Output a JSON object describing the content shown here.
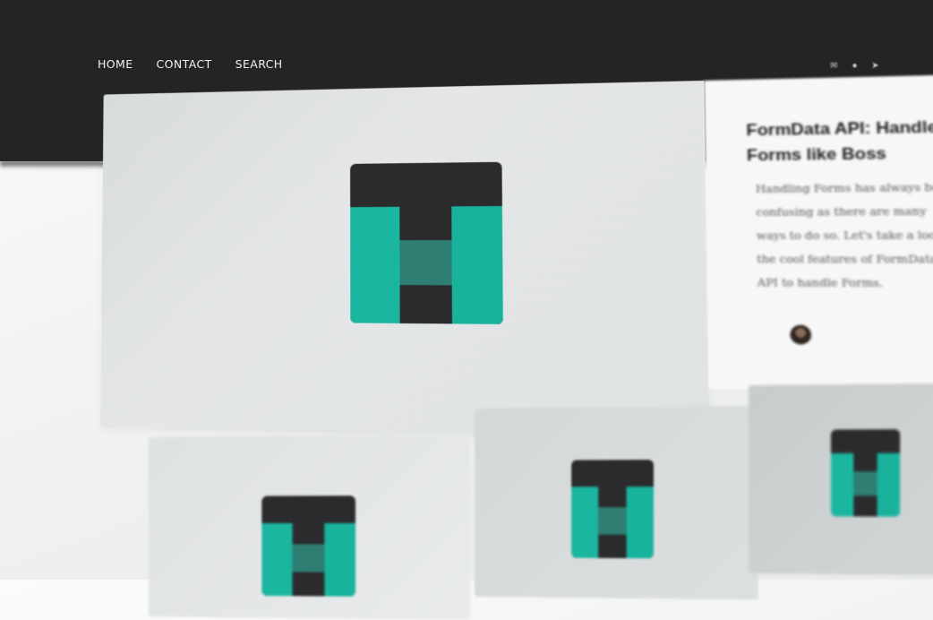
{
  "nav": {
    "items": [
      {
        "label": "HOME"
      },
      {
        "label": "CONTACT"
      },
      {
        "label": "SEARCH"
      }
    ]
  },
  "header_icons": [
    "mail-icon",
    "user-icon",
    "send-icon"
  ],
  "featured": {
    "kicker": "",
    "title": "FormData API: Handle Forms like Boss",
    "excerpt": "Handling Forms has always been confusing as there are many ways to do so. Let's take a look at the cool features of FormData API to handle Forms.",
    "date": ""
  },
  "colors": {
    "topbar": "#242424",
    "logo_dark": "#2b2b2d",
    "logo_teal": "#1bb6a0"
  }
}
